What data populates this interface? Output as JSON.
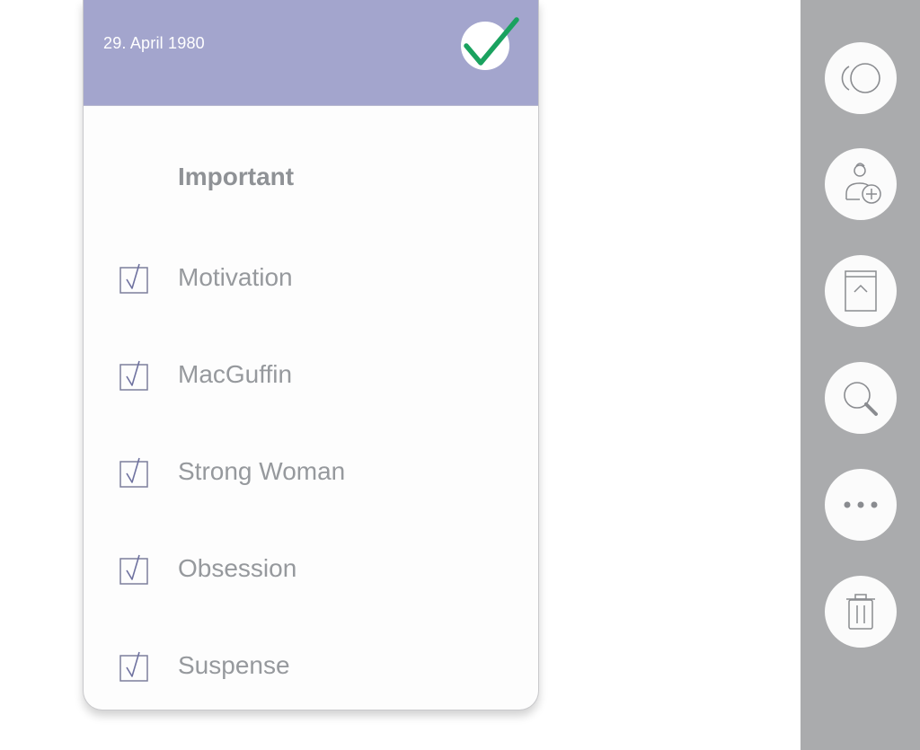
{
  "card": {
    "date": "29. April 1980",
    "section_title": "Important",
    "items": [
      {
        "label": "Motivation",
        "checked": true
      },
      {
        "label": "MacGuffin",
        "checked": true
      },
      {
        "label": "Strong Woman",
        "checked": true
      },
      {
        "label": "Obsession",
        "checked": true
      },
      {
        "label": "Suspense",
        "checked": true
      }
    ]
  },
  "toolbar": {
    "buttons": [
      {
        "icon": "circles-icon"
      },
      {
        "icon": "add-user-icon"
      },
      {
        "icon": "archive-icon"
      },
      {
        "icon": "search-icon"
      },
      {
        "icon": "more-icon"
      },
      {
        "icon": "trash-icon"
      }
    ]
  },
  "colors": {
    "header": "#a3a5cd",
    "check_accent": "#1aa25f",
    "rail": "#aaabad",
    "text_muted": "#96999d"
  }
}
